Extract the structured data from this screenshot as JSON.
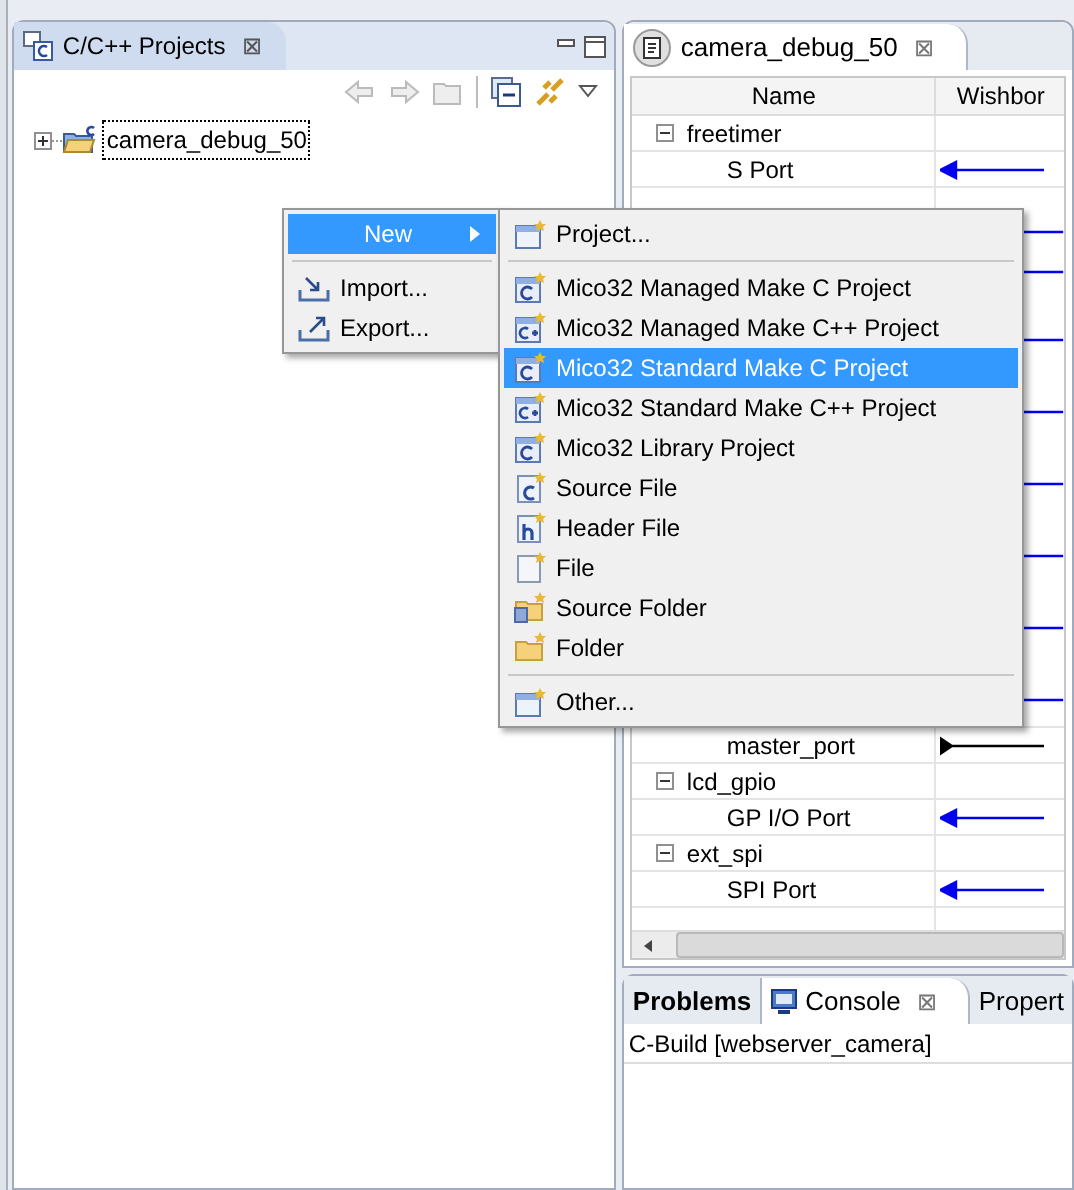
{
  "projects_view": {
    "tab": {
      "title": "C/C++ Projects",
      "close": "⊠"
    },
    "tree": [
      {
        "label": "camera_debug_50",
        "expanded": false
      }
    ]
  },
  "context_menu": {
    "items": [
      {
        "kind": "submenu",
        "label": "New",
        "selected": true
      },
      {
        "kind": "separator"
      },
      {
        "kind": "item",
        "label": "Import...",
        "selected": false
      },
      {
        "kind": "item",
        "label": "Export...",
        "selected": false
      }
    ]
  },
  "new_submenu": {
    "items": [
      {
        "kind": "item",
        "label": "Project...",
        "selected": false
      },
      {
        "kind": "separator"
      },
      {
        "kind": "item",
        "label": "Mico32 Managed Make C Project",
        "selected": false
      },
      {
        "kind": "item",
        "label": "Mico32 Managed Make C++  Project",
        "selected": false
      },
      {
        "kind": "item",
        "label": "Mico32 Standard Make C Project",
        "selected": true
      },
      {
        "kind": "item",
        "label": "Mico32 Standard Make C++ Project",
        "selected": false
      },
      {
        "kind": "item",
        "label": "Mico32 Library Project",
        "selected": false
      },
      {
        "kind": "item",
        "label": "Source File",
        "selected": false
      },
      {
        "kind": "item",
        "label": "Header File",
        "selected": false
      },
      {
        "kind": "item",
        "label": "File",
        "selected": false
      },
      {
        "kind": "item",
        "label": "Source Folder",
        "selected": false
      },
      {
        "kind": "item",
        "label": "Folder",
        "selected": false
      },
      {
        "kind": "separator"
      },
      {
        "kind": "item",
        "label": "Other...",
        "selected": false
      }
    ]
  },
  "editor": {
    "tab": {
      "title": "camera_debug_50",
      "close": "⊠"
    },
    "columns": [
      "Name",
      "Wishbor"
    ],
    "rows_top": [
      {
        "kind": "group",
        "name": "freetimer",
        "expanded": true
      },
      {
        "kind": "slave",
        "name": "S Port"
      }
    ],
    "rows_bottom": [
      {
        "kind": "master",
        "name": "master_port"
      },
      {
        "kind": "group",
        "name": "lcd_gpio",
        "expanded": true
      },
      {
        "kind": "slave",
        "name": "GP I/O Port"
      },
      {
        "kind": "group",
        "name": "ext_spi",
        "expanded": true
      },
      {
        "kind": "slave",
        "name": "SPI Port"
      }
    ]
  },
  "bottom_panel": {
    "tabs": [
      {
        "label": "Problems",
        "selected": false
      },
      {
        "label": "Console",
        "selected": true,
        "close": "⊠"
      },
      {
        "label": "Propert",
        "selected": false
      }
    ],
    "console_title": "C-Build [webserver_camera]"
  }
}
